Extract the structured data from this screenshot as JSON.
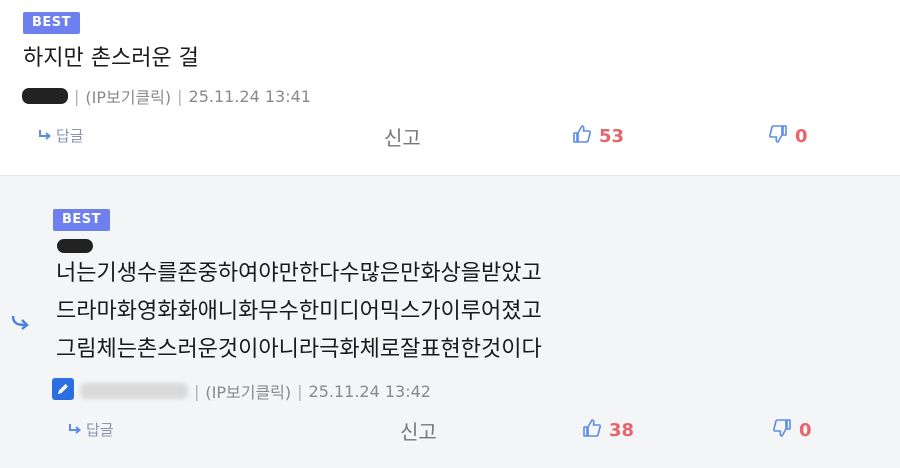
{
  "comment1": {
    "badge": "BEST",
    "text": "하지만 촌스러운 걸",
    "meta": {
      "ip_link": "(IP보기클릭)",
      "timestamp": "25.11.24 13:41"
    },
    "actions": {
      "reply_label": "답글",
      "report_label": "신고",
      "upvotes": "53",
      "downvotes": "0"
    }
  },
  "comment2": {
    "badge": "BEST",
    "lines": [
      "너는기생수를존중하여야만한다수많은만화상을받았고",
      "드라마화영화화애니화무수한미디어믹스가이루어졌고",
      "그림체는촌스러운것이아니라극화체로잘표현한것이다"
    ],
    "meta": {
      "ip_link": "(IP보기클릭)",
      "timestamp": "25.11.24 13:42"
    },
    "actions": {
      "reply_label": "답글",
      "report_label": "신고",
      "upvotes": "38",
      "downvotes": "0"
    }
  },
  "colors": {
    "badge": "#6e7ff0",
    "vote_number": "#e8646b",
    "icon_blue": "#5b8de8",
    "reply_background": "#f3f5f7"
  },
  "icons": [
    "reply-arrow-icon",
    "thumbs-up-icon",
    "thumbs-down-icon",
    "nested-reply-icon",
    "edit-pencil-icon"
  ]
}
